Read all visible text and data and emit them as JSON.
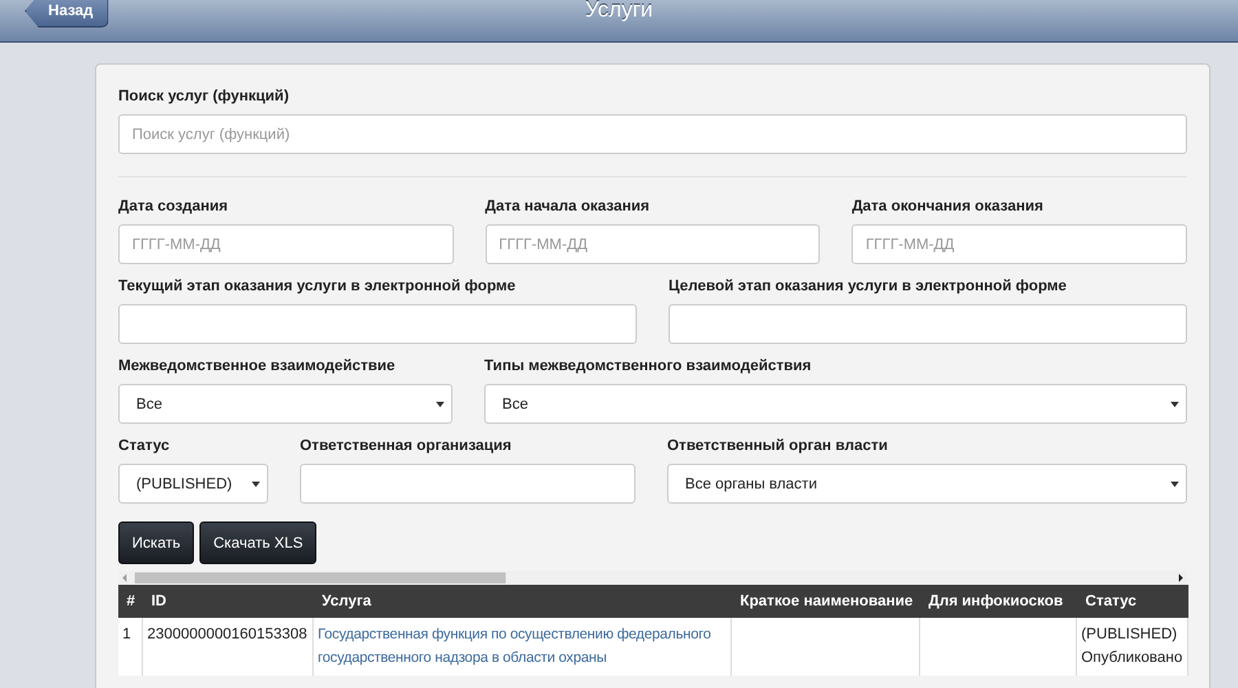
{
  "header": {
    "back_button": "Назад",
    "title": "Услуги"
  },
  "search": {
    "label": "Поиск услуг (функций)",
    "placeholder": "Поиск услуг (функций)"
  },
  "filter_rows": [
    [
      {
        "kind": "input",
        "label": "Дата создания",
        "placeholder": "ГГГГ-ММ-ДД"
      },
      {
        "kind": "input",
        "label": "Дата начала оказания",
        "placeholder": "ГГГГ-ММ-ДД"
      },
      {
        "kind": "input",
        "label": "Дата окончания оказания",
        "placeholder": "ГГГГ-ММ-ДД"
      }
    ],
    [
      {
        "kind": "input",
        "label": "Текущий этап оказания услуги в электронной форме"
      },
      {
        "kind": "input",
        "label": "Целевой этап оказания услуги в электронной форме"
      }
    ],
    [
      {
        "kind": "select",
        "label": "Межведомственное взаимодействие",
        "value": "Все"
      },
      {
        "kind": "select",
        "label": "Типы межведомственного взаимодействия",
        "value": "Все"
      }
    ],
    [
      {
        "kind": "select",
        "label": "Статус",
        "value": "(PUBLISHED)"
      },
      {
        "kind": "input",
        "label": "Ответственная организация"
      },
      {
        "kind": "select",
        "label": "Ответственный орган власти",
        "value": "Все органы власти"
      }
    ]
  ],
  "buttons": [
    "Искать",
    "Скачать XLS"
  ],
  "table": {
    "columns": [
      "#",
      "ID",
      "Услуга",
      "Краткое наименование",
      "Для инфокиосков",
      "Статус"
    ],
    "rows": [
      {
        "number": "1",
        "id": "2300000000160153308",
        "service": "Государственная функция по осуществлению федерального государственного надзора в области охраны",
        "short_name": "",
        "kiosk": "",
        "status": "(PUBLISHED) Опубликовано"
      }
    ]
  }
}
